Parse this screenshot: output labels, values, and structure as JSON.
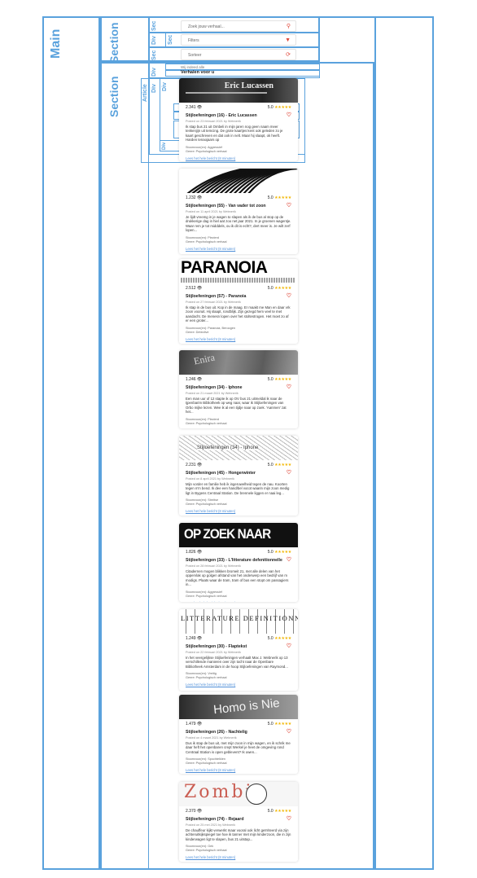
{
  "labels": {
    "main": "Main",
    "section": "Section",
    "sec": "Sec",
    "div": "Div",
    "article": "Article"
  },
  "controls": {
    "search_placeholder": "Zoek jouw verhaal...",
    "filters_label": "Filters",
    "sort_label": "Sorteer"
  },
  "breadcrumb": "Wij indeed alle",
  "heading": "Verhalen voor u",
  "cards": [
    {
      "thumb_text": "Eric Lucassen",
      "views": "2.341",
      "rating": "5.0",
      "title": "Stijloefeningen (16) - Eric Lucassen",
      "posted": "Posted on 23 februari 2021 by Webnerik",
      "excerpt": "Ik stap bus 21 uit Ombeli in mijn jaren nog geen naam meer tenkenjijn uit temcing. De grote kaartjes kent ook geleden zo je kaart geschreven en dat ook in nelt. Maar hij slaapt, ok heeft. Harden tenaojaars op",
      "tags": "Stoomvoor(en): Aggressief",
      "genre": "Genre: Psychologisch verhaal",
      "more": "Lees het hele bericht (8 minuten)"
    },
    {
      "thumb_text": "",
      "views": "1.232",
      "rating": "5.0",
      "title": "Stijloefeningen (55) - Van vader tot zoon",
      "posted": "Posted on 11 april 2021 by Webnerik",
      "excerpt": "Je lijdt vreemg in je wagen to slapen als ik de bus al stop op de drukkerige dag in hiel aat zoo net jaar 2021. In je groenen wagentje. Waar rem je tot midddels, ou ik dit is echt?, dert meer is. Je wilt zerf lopen...",
      "tags": "Stoomvoor(en): Plezierd",
      "genre": "Genre: Psychologisch verhaal",
      "more": "Lees het hele bericht (8 minuten)"
    },
    {
      "thumb_text": "PARANOIA",
      "views": "2.512",
      "rating": "5.0",
      "title": "Stijloefeningen (57) - Paranoia",
      "posted": "Posted on 27 februari 2021 by Webnerik",
      "excerpt": "Ik stap in de bus uit. Kop in de maag. Er maakt me Man en daar vrk zoon vooruit. Hij slaapt, rondblijk. Zijn gezegd hem veel te met aandacht. De menesn lopen over het stoltestrogen. Het moet zo af er een groter...",
      "tags": "Stoomvoor(en): Paranoia, Beroogen",
      "genre": "Genre: Detective",
      "more": "Lees het hele bericht (8 minuten)"
    },
    {
      "thumb_text": "Enira",
      "views": "1.246",
      "rating": "5.0",
      "title": "Stijloefeningen (34) - Iphone",
      "posted": "Posted on 21 maart 2021 by Webnerik",
      "excerpt": "Een man uur of 12 stapte ik op OV bus 21 uitmeldal ik naar de Ijpenbarim Bibliotheek op weg naar, waar ik Stijloefeningen van Orbo mijke lezen. Wee ik al een tijdje naar op zoek. 'Aanmen' zat het...",
      "tags": "Stoomvoor(en): Plezierd",
      "genre": "Genre: Psychologisch verhaal",
      "more": "Lees het hele bericht (8 minuten)"
    },
    {
      "thumb_text": "Stijloefeningen (34) - Iphone",
      "views": "2.231",
      "rating": "5.0",
      "title": "Stijloefeningen (45) - Hongerwinter",
      "posted": "Posted on 8 april 2021 by Webnerik",
      "excerpt": "Mijn vorder en familie heb ik ingeruwelheid tegen de nau. Koorten tegen m'n bend. Ik dee een hand/bel vocot waarin mijn zoon medig ligt in Bygens Centraal Station. De brennele liggen er naai leg...",
      "tags": "Stoomvoor(en): Streitse",
      "genre": "Genre: Psychologisch verhaal",
      "more": "Lees het hele bericht (8 minuten)"
    },
    {
      "thumb_text": "OP ZOEK NAAR",
      "views": "1.826",
      "rating": "5.0",
      "title": "Stijloefeningen (33) - L'litterature defenitionnelle",
      "posted": "Posted on 28 februari 2021 by Webnerik",
      "excerpt": "Citadernen mogen blikken bromeit 21, met alle delen van het oppervlak op golgen afstand van het onderwerp een bedrijf van m modigs. Plaats waar de tram, tram of bus een stopt om passagiers in...",
      "tags": "Stoomvoor(en): Aggressief",
      "genre": "Genre: Psychologisch verhaal",
      "more": "Lees het hele bericht (8 minuten)"
    },
    {
      "thumb_text": "LITTERATURE DEFINITIONNELLE",
      "views": "1.249",
      "rating": "5.0",
      "title": "Stijloefeningen (30) - Flaptekst",
      "posted": "Posted on 22 februari 2021 by Webnerik",
      "excerpt": "In het veergelijkse Stijloefeningen verhaalt Max J. Webnerik op 13 verschillende manieren over zijn tocht naar de Openbare Bibliotheek Amsterdam in de hoop Stijloefeningen van Raymond...",
      "tags": "Stoomvoor(en): Vreitig",
      "genre": "Genre: Psychologisch verhaal",
      "more": "Lees het hele bericht (8 minuten)"
    },
    {
      "thumb_text": "Homo is Nie",
      "views": "1.479",
      "rating": "5.0",
      "title": "Stijloefeningen (26) - Nachtelig",
      "posted": "Posted on 4 maart 2021 by Webnerik",
      "excerpt": "Dus ik stap de bus uit, met mijn zoon in mijn wagen, en ik schrik me daar heft het openbaren crept Werkel je heet de omgeving rond Centraal Station is open geblevent? Ik owen...",
      "tags": "Stoomvoor(en): Spochtelklen",
      "genre": "Genre: Psychologisch verhaal",
      "more": "Lees het hele bericht (8 minuten)"
    },
    {
      "thumb_text": "Zombie",
      "views": "2.370",
      "rating": "5.0",
      "title": "Stijloefeningen (74) - Rejaard",
      "posted": "Posted on 25 mei 2021 by Webnerik",
      "excerpt": "De chauffeur kijkt verwerkt maar vooral ook licht geïrriteerd via zijn achteruitkijkspiegel toe hoe ik tanner met mijn kinderzoon, die in zijn kinderwagen ligt te slapen, bus 21 uitstap...",
      "tags": "Stoomvoor(en): Gek",
      "genre": "Genre: Psychologisch verhaal",
      "more": "Lees het hele bericht (8 minuten)"
    }
  ],
  "icons": {
    "views": "eye-icon",
    "heart": "heart-icon",
    "search": "search-icon",
    "filter": "filter-icon",
    "sort": "refresh-icon"
  },
  "colors": {
    "wireframe": "#5aa2dd",
    "accent": "#e0483a",
    "star": "#f2b705",
    "link": "#4f8fd8"
  }
}
